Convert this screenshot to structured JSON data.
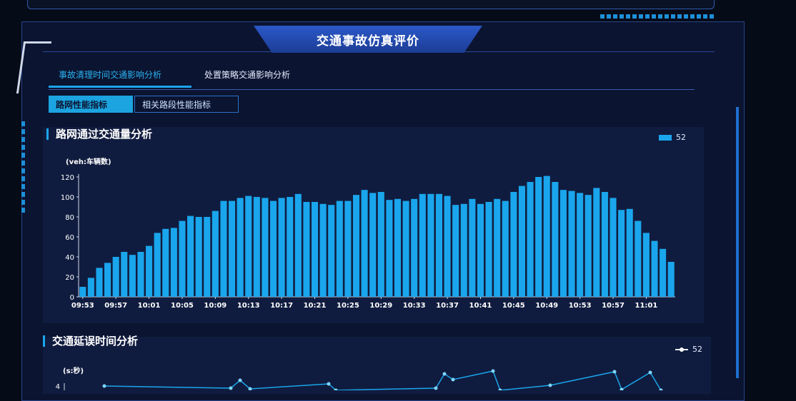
{
  "page": {
    "title": "交通事故仿真评价",
    "tabs": [
      {
        "label": "事故清理时间交通影响分析",
        "active": true
      },
      {
        "label": "处置策略交通影响分析",
        "active": false
      }
    ],
    "subtabs": [
      {
        "label": "路网性能指标",
        "active": true
      },
      {
        "label": "相关路段性能指标",
        "active": false
      }
    ]
  },
  "colors": {
    "accent": "#1aa6ec",
    "panel": "#0b1430",
    "chart_bg": "#101c3f"
  },
  "chart_data": [
    {
      "type": "bar",
      "title": "路网通过交通量分析",
      "ylabel": "(veh:车辆数)",
      "ylim": [
        0,
        120
      ],
      "yticks": [
        0,
        20,
        40,
        60,
        80,
        100,
        120
      ],
      "legend": {
        "label": "52",
        "position": "top-right"
      },
      "categories": [
        "09:53",
        "09:54",
        "09:55",
        "09:56",
        "09:57",
        "09:58",
        "09:59",
        "10:00",
        "10:01",
        "10:02",
        "10:03",
        "10:04",
        "10:05",
        "10:06",
        "10:07",
        "10:08",
        "10:09",
        "10:10",
        "10:11",
        "10:12",
        "10:13",
        "10:14",
        "10:15",
        "10:16",
        "10:17",
        "10:18",
        "10:19",
        "10:20",
        "10:21",
        "10:22",
        "10:23",
        "10:24",
        "10:25",
        "10:26",
        "10:27",
        "10:28",
        "10:29",
        "10:30",
        "10:31",
        "10:32",
        "10:33",
        "10:34",
        "10:35",
        "10:36",
        "10:37",
        "10:38",
        "10:39",
        "10:40",
        "10:41",
        "10:42",
        "10:43",
        "10:44",
        "10:45",
        "10:46",
        "10:47",
        "10:48",
        "10:49",
        "10:50",
        "10:51",
        "10:52",
        "10:53",
        "10:54",
        "10:55",
        "10:56",
        "10:57",
        "10:58",
        "10:59",
        "11:00",
        "11:01",
        "11:02",
        "11:03"
      ],
      "tick_labels": [
        "09:53",
        "09:57",
        "10:01",
        "10:05",
        "10:09",
        "10:13",
        "10:17",
        "10:21",
        "10:25",
        "10:29",
        "10:33",
        "10:37",
        "10:41",
        "10:45",
        "10:49",
        "10:53",
        "10:57",
        "11:01"
      ],
      "values": [
        10,
        19,
        29,
        34,
        40,
        45,
        42,
        45,
        51,
        64,
        68,
        69,
        76,
        81,
        80,
        80,
        86,
        96,
        96,
        99,
        101,
        100,
        99,
        96,
        99,
        100,
        103,
        95,
        95,
        93,
        92,
        96,
        96,
        102,
        107,
        104,
        105,
        97,
        98,
        96,
        98,
        103,
        103,
        103,
        101,
        92,
        93,
        98,
        93,
        95,
        98,
        96,
        105,
        111,
        115,
        120,
        121,
        115,
        107,
        106,
        104,
        102,
        109,
        105,
        99,
        87,
        88,
        76,
        64,
        56,
        48,
        35
      ]
    },
    {
      "type": "line",
      "title": "交通延误时间分析",
      "ylabel": "(s:秒)",
      "legend": {
        "label": "52",
        "position": "top-right"
      },
      "yticks_visible": [
        "4"
      ]
    }
  ]
}
